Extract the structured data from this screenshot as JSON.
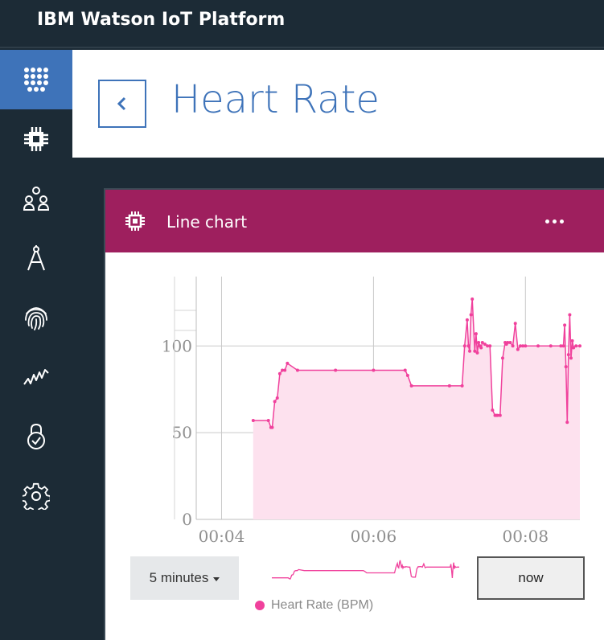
{
  "app": {
    "title": "IBM Watson IoT Platform"
  },
  "sidebar": {
    "items": [
      {
        "name": "apps-grid-icon",
        "active": true
      },
      {
        "name": "chip-icon"
      },
      {
        "name": "members-icon"
      },
      {
        "name": "compass-icon"
      },
      {
        "name": "fingerprint-icon"
      },
      {
        "name": "activity-chart-icon"
      },
      {
        "name": "lock-check-icon"
      },
      {
        "name": "gear-icon"
      }
    ]
  },
  "page": {
    "title": "Heart Rate",
    "back_icon": "chevron-left-icon"
  },
  "card": {
    "title": "Line chart",
    "icon": "chip-icon",
    "menu_icon": "more-horizontal-icon",
    "header_color": "#9e1f5e"
  },
  "controls": {
    "range": "5 minutes",
    "now_label": "now"
  },
  "legend": {
    "label": "Heart Rate (BPM)",
    "color": "#f0419c"
  },
  "chart_data": {
    "type": "area",
    "x_ticks": [
      "00:04",
      "00:06",
      "00:08"
    ],
    "y_ticks": [
      "0",
      "50",
      "100"
    ],
    "ylim": [
      0,
      140
    ],
    "xlim": [
      "00:03:40",
      "00:08:43"
    ],
    "grid": true,
    "series": [
      {
        "name": "Heart Rate (BPM)",
        "color": "#f0419c",
        "x": [
          "00:04:25",
          "00:04:37",
          "00:04:39",
          "00:04:40",
          "00:04:42",
          "00:04:44",
          "00:04:46",
          "00:04:48",
          "00:04:50",
          "00:04:52",
          "00:05:00",
          "00:05:30",
          "00:06:00",
          "00:06:25",
          "00:06:27",
          "00:06:30",
          "00:07:00",
          "00:07:10",
          "00:07:12",
          "00:07:14",
          "00:07:15",
          "00:07:16",
          "00:07:17",
          "00:07:18",
          "00:07:20",
          "00:07:21",
          "00:07:22",
          "00:07:23",
          "00:07:24",
          "00:07:25",
          "00:07:26",
          "00:07:28",
          "00:07:30",
          "00:07:32",
          "00:07:34",
          "00:07:36",
          "00:07:37",
          "00:07:38",
          "00:07:40",
          "00:07:42",
          "00:07:44",
          "00:07:45",
          "00:07:46",
          "00:07:48",
          "00:07:50",
          "00:07:52",
          "00:07:54",
          "00:07:56",
          "00:07:58",
          "00:08:00",
          "00:08:10",
          "00:08:20",
          "00:08:28",
          "00:08:30",
          "00:08:31",
          "00:08:32",
          "00:08:33",
          "00:08:34",
          "00:08:35",
          "00:08:36",
          "00:08:37",
          "00:08:38",
          "00:08:40",
          "00:08:43"
        ],
        "values": [
          57,
          57,
          53,
          53,
          68,
          70,
          84,
          86,
          86,
          90,
          86,
          86,
          86,
          86,
          83,
          77,
          77,
          77,
          100,
          115,
          100,
          97,
          118,
          127,
          97,
          107,
          96,
          102,
          100,
          99,
          102,
          101,
          100,
          100,
          63,
          60,
          60,
          60,
          60,
          93,
          102,
          101,
          102,
          102,
          100,
          113,
          98,
          100,
          100,
          100,
          100,
          100,
          100,
          100,
          112,
          88,
          56,
          95,
          118,
          93,
          103,
          99,
          100,
          100
        ]
      }
    ]
  }
}
